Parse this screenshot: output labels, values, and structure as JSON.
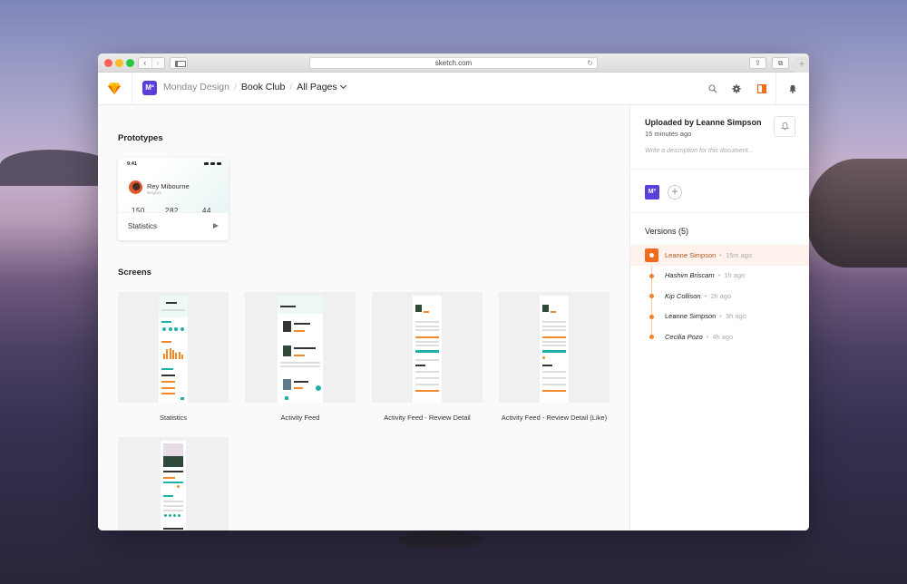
{
  "browser": {
    "url": "sketch.com",
    "back_glyph": "‹",
    "forward_glyph": "›",
    "reload_glyph": "↻",
    "share_glyph": "⇪",
    "tabs_glyph": "⧉",
    "newtab_glyph": "+"
  },
  "appbar": {
    "team_badge": "Mº",
    "breadcrumb": {
      "team": "Monday Design",
      "document": "Book Club",
      "pages": "All Pages",
      "separator": "/"
    },
    "accent_color": "#f26a1b",
    "brand_color": "#5b3fd8"
  },
  "main": {
    "prototypes_title": "Prototypes",
    "prototype": {
      "label": "Statistics",
      "preview": {
        "time": "9:41",
        "name": "Rey Mibourne",
        "location": "Belgium",
        "stats": [
          "150",
          "282",
          "44"
        ]
      }
    },
    "screens_title": "Screens",
    "screens": [
      {
        "label": "Statistics"
      },
      {
        "label": "Activity Feed"
      },
      {
        "label": "Activity Feed - Review Detail"
      },
      {
        "label": "Activity Feed - Review Detail (Like)"
      },
      {
        "label": ""
      }
    ]
  },
  "sidebar": {
    "upload_title": "Uploaded by Leanne Simpson",
    "upload_time": "15 minutes ago",
    "description_placeholder": "Write a description for this document...",
    "team_badge": "Mº",
    "add_glyph": "+",
    "versions_title": "Versions (5)",
    "versions": [
      {
        "name": "Leanne Simpson",
        "time": "15m ago",
        "active": true
      },
      {
        "name": "Hashim Briscam",
        "time": "1h ago",
        "active": false
      },
      {
        "name": "Kip Collison",
        "time": "2h ago",
        "active": false
      },
      {
        "name": "Leanne Simpson",
        "time": "3h ago",
        "active": false
      },
      {
        "name": "Cecilia Pozo",
        "time": "4h ago",
        "active": false
      }
    ],
    "bullet": "•"
  }
}
